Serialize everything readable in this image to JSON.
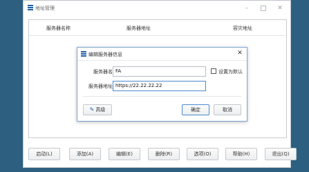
{
  "main_window": {
    "title": "地址管理",
    "controls": {
      "minimize": "–",
      "close": "✕"
    }
  },
  "table": {
    "columns": [
      "服务器名称",
      "服务器地址",
      "容灾地址"
    ]
  },
  "bottom_buttons": [
    "启动(L)",
    "添加(A)",
    "编辑(E)",
    "删除(R)",
    "选项(O)",
    "帮助(H)",
    "退出(Q)"
  ],
  "dialog": {
    "title": "编辑服务器信息",
    "close": "✕",
    "name_label": "服务器名：",
    "name_value": "FA",
    "address_label": "服务器地址：",
    "address_value": "https://22.22.22.22",
    "default_label": "设置为默认",
    "advanced_label": "高级",
    "ok_label": "确定",
    "cancel_label": "取消"
  }
}
